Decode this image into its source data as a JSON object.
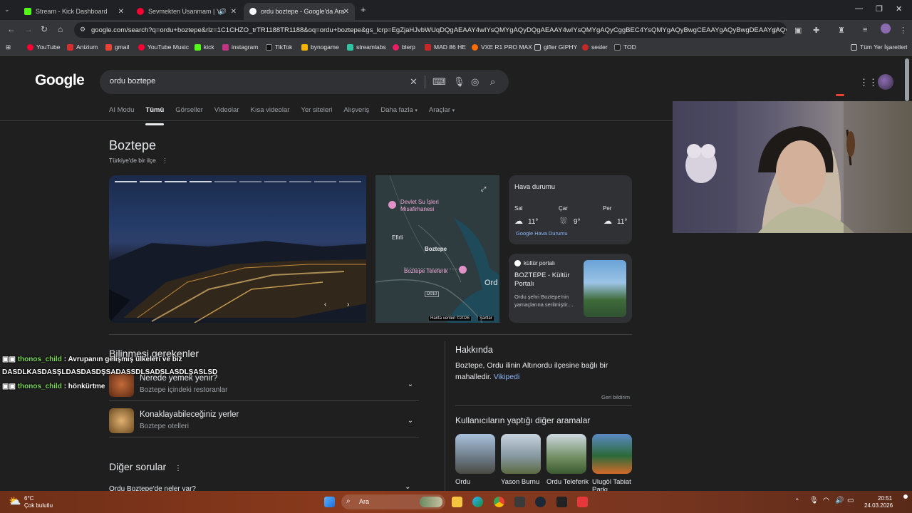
{
  "browser": {
    "tabs": [
      {
        "title": "Stream - Kick Dashboard",
        "favicon": "kick-icon",
        "color": "#53fc18"
      },
      {
        "title": "Sevmekten Usanmam | You",
        "favicon": "youtube-icon",
        "color": "#ff0033"
      },
      {
        "title": "ordu boztepe - Google'da Ara",
        "favicon": "google-icon",
        "color": "#ffffff"
      }
    ],
    "url": "google.com/search?q=ordu+boztepe&rlz=1C1CHZO_trTR1188TR1188&oq=ordu+boztepe&gs_lcrp=EgZjaHJvbWUqDQgAEAAY4wIYsQMYgAQyDQgAEAAY4wIYsQMYgAQyCggBEC4YsQMYgAQyBwgCEAAYgAQyBwgDEAAYgAQyD...",
    "bookmarks": [
      "YouTube",
      "Anizium",
      "gmail",
      "YouTube Music",
      "kick",
      "instagram",
      "TikTok",
      "bynogame",
      "streamlabs",
      "blerp",
      "MAD 86 HE",
      "VXE R1 PRO MAX",
      "gifler GIPHY",
      "sesler",
      "TOD"
    ],
    "all_bookmarks": "Tüm Yer İşaretleri"
  },
  "google": {
    "logo": "Google",
    "query": "ordu boztepe",
    "filters": [
      "AI Modu",
      "Tümü",
      "Görseller",
      "Videolar",
      "Kısa videolar",
      "Yer siteleri",
      "Alışveriş",
      "Daha fazla",
      "Araçlar"
    ],
    "active_filter": 1,
    "kp": {
      "title": "Boztepe",
      "subtitle": "Türkiye'de bir ilçe",
      "map": {
        "labels": [
          "Devlet Su İşleri Misafirhanesi",
          "Efirli",
          "Boztepe",
          "Boztepe Teleferik",
          "Ord",
          "D010"
        ],
        "credit": "Harita verileri ©2026",
        "terms": "Şartlar"
      },
      "weather": {
        "title": "Hava durumu",
        "days": [
          {
            "day": "Sal",
            "temp": "11°",
            "icon": "cloud-icon"
          },
          {
            "day": "Çar",
            "temp": "9°",
            "icon": "rain-cloud-icon"
          },
          {
            "day": "Per",
            "temp": "11°",
            "icon": "cloud-icon"
          }
        ],
        "source": "Google Hava Durumu"
      },
      "kultur": {
        "source": "kültür portalı",
        "title": "BOZTEPE - Kültür Portalı",
        "snippet": "Ordu şehri Boztepe'nin yamaçlarına serilmiştir...."
      }
    },
    "need_to_know": {
      "title": "Bilinmesi gerekenler",
      "items": [
        {
          "title": "Nerede yemek yenir?",
          "sub": "Boztepe içindeki restoranlar"
        },
        {
          "title": "Konaklayabileceğiniz yerler",
          "sub": "Boztepe otelleri"
        }
      ]
    },
    "other_questions": {
      "title": "Diğer sorular",
      "first": "Ordu Boztepe'de neler var?"
    },
    "about": {
      "title": "Hakkında",
      "text": "Boztepe, Ordu ilinin Altınordu ilçesine bağlı bir mahalledir.",
      "link": "Vikipedi",
      "feedback": "Geri bildirim"
    },
    "related": {
      "title": "Kullanıcıların yaptığı diğer aramalar",
      "items": [
        "Ordu",
        "Yason Burnu",
        "Ordu Teleferik",
        "Ulugöl Tabiat Parkı"
      ]
    }
  },
  "chat": [
    {
      "user": "thonos_child",
      "msg": ": Avrupanın gelişmiş ülkeleri ve biz"
    },
    {
      "user": "",
      "msg": "DASDLKASDASŞLDASDASDŞSADASSDLSADSLASDLŞASLSD"
    },
    {
      "user": "thonos_child",
      "msg": ": hönkürtme"
    }
  ],
  "taskbar": {
    "weather_temp": "6°C",
    "weather_desc": "Çok bulutlu",
    "search": "Ara",
    "time": "20:51",
    "date": "24.03.2026"
  }
}
